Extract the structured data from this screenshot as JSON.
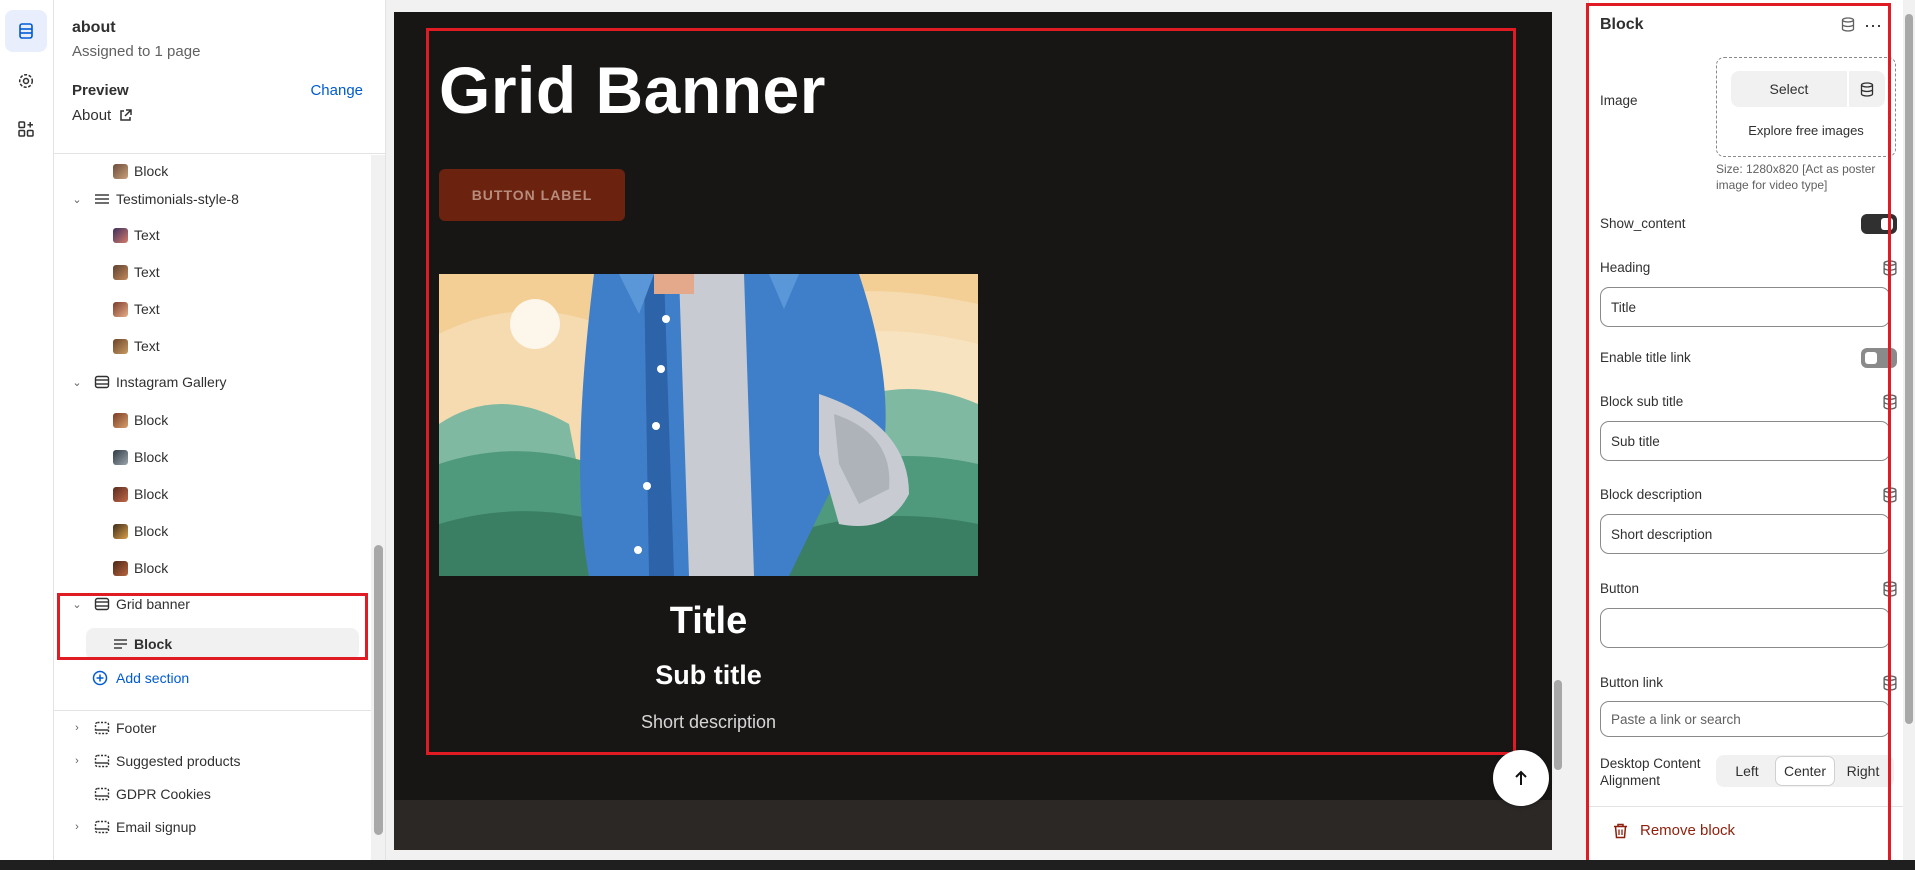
{
  "rail": {
    "items": [
      {
        "name": "sections",
        "icon": "sections-icon"
      },
      {
        "name": "settings",
        "icon": "gear-icon"
      },
      {
        "name": "apps",
        "icon": "apps-icon"
      }
    ]
  },
  "sidebar": {
    "template_name": "about",
    "assigned": "Assigned to 1 page",
    "preview_label": "Preview",
    "change_label": "Change",
    "preview_page": "About",
    "tree": [
      {
        "label": "Block",
        "level": 2,
        "thumb": "photo"
      },
      {
        "label": "Testimonials-style-8",
        "level": 1,
        "expanded": true
      },
      {
        "label": "Text",
        "level": 2,
        "thumb": "photo"
      },
      {
        "label": "Text",
        "level": 2,
        "thumb": "photo"
      },
      {
        "label": "Text",
        "level": 2,
        "thumb": "photo"
      },
      {
        "label": "Text",
        "level": 2,
        "thumb": "photo"
      },
      {
        "label": "Instagram Gallery",
        "level": 1,
        "expanded": true
      },
      {
        "label": "Block",
        "level": 2,
        "thumb": "photo"
      },
      {
        "label": "Block",
        "level": 2,
        "thumb": "photo"
      },
      {
        "label": "Block",
        "level": 2,
        "thumb": "photo"
      },
      {
        "label": "Block",
        "level": 2,
        "thumb": "photo"
      },
      {
        "label": "Block",
        "level": 2,
        "thumb": "photo"
      },
      {
        "label": "Grid banner",
        "level": 1,
        "expanded": true
      },
      {
        "label": "Block",
        "level": 2,
        "selected": true
      }
    ],
    "add_section": "Add section",
    "bottom": [
      {
        "label": "Footer",
        "expandable": true
      },
      {
        "label": "Suggested products",
        "expandable": true
      },
      {
        "label": "GDPR Cookies",
        "expandable": false
      },
      {
        "label": "Email signup",
        "expandable": true
      }
    ]
  },
  "canvas": {
    "banner_title": "Grid Banner",
    "button_label": "BUTTON LABEL",
    "card_title": "Title",
    "card_subtitle": "Sub title",
    "card_description": "Short description"
  },
  "panel": {
    "title": "Block",
    "image_label": "Image",
    "select_label": "Select",
    "explore_label": "Explore free images",
    "size_note": "Size: 1280x820 [Act as poster image for video type]",
    "show_content_label": "Show_content",
    "show_content_on": true,
    "heading_label": "Heading",
    "heading_value": "Title",
    "enable_title_link_label": "Enable title link",
    "enable_title_link_on": false,
    "sub_title_label": "Block sub title",
    "sub_title_value": "Sub title",
    "description_label": "Block description",
    "description_value": "Short description",
    "button_label": "Button",
    "button_value": "",
    "button_link_label": "Button link",
    "button_link_placeholder": "Paste a link or search",
    "alignment_label": "Desktop Content Alignment",
    "alignment_options": [
      "Left",
      "Center",
      "Right"
    ],
    "alignment_selected": "Center",
    "remove_label": "Remove block"
  },
  "colors": {
    "accent": "#005bd3",
    "highlight": "#e01b24",
    "banner_bg": "#181615",
    "button_bg": "#6b2310"
  }
}
